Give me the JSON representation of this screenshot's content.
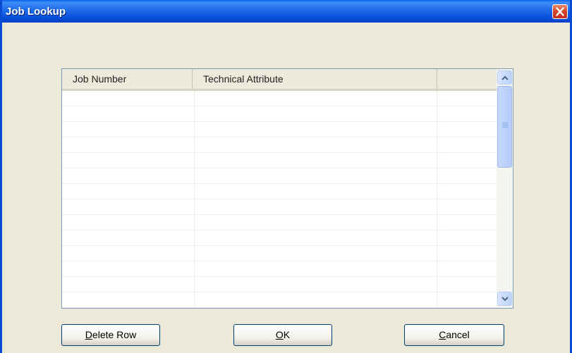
{
  "window": {
    "title": "Job Lookup"
  },
  "grid": {
    "columns": [
      {
        "label": "Job Number"
      },
      {
        "label": "Technical Attribute"
      },
      {
        "label": ""
      }
    ],
    "row_count": 14
  },
  "buttons": {
    "delete_row": {
      "accesskey": "D",
      "rest": "elete Row"
    },
    "ok": {
      "accesskey": "O",
      "rest": "K"
    },
    "cancel": {
      "accesskey": "C",
      "rest": "ancel"
    }
  },
  "icons": {
    "close": "close-icon",
    "scroll_up": "chevron-up-icon",
    "scroll_down": "chevron-down-icon"
  },
  "colors": {
    "titlebar": "#0A5FE6",
    "dialog_bg": "#ECE9D8",
    "close_button": "#D4432B",
    "grid_border": "#7F9DB9"
  }
}
